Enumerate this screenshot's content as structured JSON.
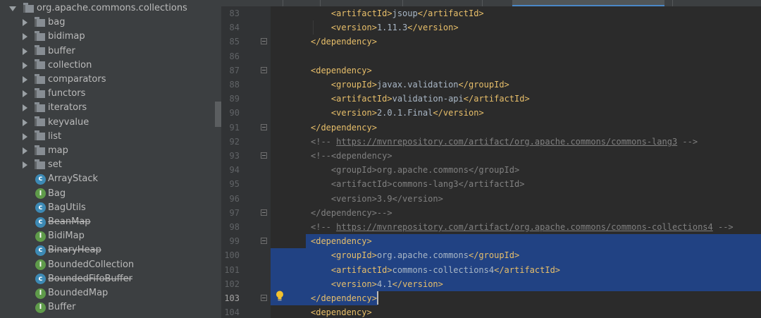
{
  "project_tree": {
    "root": {
      "label": "org.apache.commons.collections",
      "expanded": true
    },
    "folders": [
      "bag",
      "bidimap",
      "buffer",
      "collection",
      "comparators",
      "functors",
      "iterators",
      "keyvalue",
      "list",
      "map",
      "set"
    ],
    "classes": [
      {
        "label": "ArrayStack",
        "kind": "class",
        "deprecated": false
      },
      {
        "label": "Bag",
        "kind": "interface",
        "deprecated": false
      },
      {
        "label": "BagUtils",
        "kind": "class",
        "deprecated": false
      },
      {
        "label": "BeanMap",
        "kind": "class",
        "deprecated": true
      },
      {
        "label": "BidiMap",
        "kind": "interface",
        "deprecated": false
      },
      {
        "label": "BinaryHeap",
        "kind": "class",
        "deprecated": true
      },
      {
        "label": "BoundedCollection",
        "kind": "interface",
        "deprecated": false
      },
      {
        "label": "BoundedFifoBuffer",
        "kind": "class",
        "deprecated": true
      },
      {
        "label": "BoundedMap",
        "kind": "interface",
        "deprecated": false
      },
      {
        "label": "Buffer",
        "kind": "interface",
        "deprecated": false
      }
    ],
    "icon_letters": {
      "class": "c",
      "interface": "I"
    }
  },
  "editor": {
    "current_line": "103",
    "lines": [
      {
        "n": "83",
        "indent": "    ",
        "parts": [
          [
            "tag",
            "<artifactId>"
          ],
          [
            "txt",
            "jsoup"
          ],
          [
            "tag",
            "</artifactId>"
          ]
        ]
      },
      {
        "n": "84",
        "indent": "    ",
        "parts": [
          [
            "tag",
            "<version>"
          ],
          [
            "txt",
            "1.11.3"
          ],
          [
            "tag",
            "</version>"
          ]
        ]
      },
      {
        "n": "85",
        "indent": "",
        "parts": [
          [
            "tag",
            "</dependency>"
          ]
        ]
      },
      {
        "n": "86",
        "indent": "",
        "parts": []
      },
      {
        "n": "87",
        "indent": "",
        "parts": [
          [
            "tag",
            "<dependency>"
          ]
        ]
      },
      {
        "n": "88",
        "indent": "    ",
        "parts": [
          [
            "tag",
            "<groupId>"
          ],
          [
            "txt",
            "javax.validation"
          ],
          [
            "tag",
            "</groupId>"
          ]
        ]
      },
      {
        "n": "89",
        "indent": "    ",
        "parts": [
          [
            "tag",
            "<artifactId>"
          ],
          [
            "txt",
            "validation-api"
          ],
          [
            "tag",
            "</artifactId>"
          ]
        ]
      },
      {
        "n": "90",
        "indent": "    ",
        "parts": [
          [
            "tag",
            "<version>"
          ],
          [
            "txt",
            "2.0.1.Final"
          ],
          [
            "tag",
            "</version>"
          ]
        ]
      },
      {
        "n": "91",
        "indent": "",
        "parts": [
          [
            "tag",
            "</dependency>"
          ]
        ]
      },
      {
        "n": "92",
        "indent": "",
        "parts": [
          [
            "cmt",
            "<!-- "
          ],
          [
            "link",
            "https://mvnrepository.com/artifact/org.apache.commons/commons-lang3"
          ],
          [
            "cmt",
            " -->"
          ]
        ]
      },
      {
        "n": "93",
        "indent": "",
        "parts": [
          [
            "cmt",
            "<!--<dependency>"
          ]
        ]
      },
      {
        "n": "94",
        "indent": "    ",
        "parts": [
          [
            "cmt",
            "<groupId>org.apache.commons</groupId>"
          ]
        ]
      },
      {
        "n": "95",
        "indent": "    ",
        "parts": [
          [
            "cmt",
            "<artifactId>commons-lang3</artifactId>"
          ]
        ]
      },
      {
        "n": "96",
        "indent": "    ",
        "parts": [
          [
            "cmt",
            "<version>3.9</version>"
          ]
        ]
      },
      {
        "n": "97",
        "indent": "",
        "parts": [
          [
            "cmt",
            "</dependency>-->"
          ]
        ]
      },
      {
        "n": "98",
        "indent": "",
        "parts": [
          [
            "cmt",
            "<!-- "
          ],
          [
            "link",
            "https://mvnrepository.com/artifact/org.apache.commons/commons-collections4"
          ],
          [
            "cmt",
            " -->"
          ]
        ]
      },
      {
        "n": "99",
        "indent": "",
        "parts": [
          [
            "tag",
            "<dependency>"
          ]
        ]
      },
      {
        "n": "100",
        "indent": "    ",
        "parts": [
          [
            "tag",
            "<groupId>"
          ],
          [
            "txt",
            "org.apache.commons"
          ],
          [
            "tag",
            "</groupId>"
          ]
        ]
      },
      {
        "n": "101",
        "indent": "    ",
        "parts": [
          [
            "tag",
            "<artifactId>"
          ],
          [
            "txt",
            "commons-collections4"
          ],
          [
            "tag",
            "</artifactId>"
          ]
        ]
      },
      {
        "n": "102",
        "indent": "    ",
        "parts": [
          [
            "tag",
            "<version>"
          ],
          [
            "txt",
            "4.1"
          ],
          [
            "tag",
            "</version>"
          ]
        ]
      },
      {
        "n": "103",
        "indent": "",
        "parts": [
          [
            "tag",
            "</dependency>"
          ]
        ]
      },
      {
        "n": "104",
        "indent": "",
        "parts": [
          [
            "tag",
            "<dependency>"
          ]
        ]
      }
    ],
    "selected_lines": [
      "99",
      "100",
      "101",
      "102",
      "103"
    ],
    "folded_markers": [
      "85",
      "87",
      "91",
      "93",
      "97",
      "99",
      "103"
    ]
  },
  "colors": {
    "xml_tag": "#e8bf6a",
    "text": "#a9b7c6",
    "comment": "#808080",
    "selection": "#214283",
    "tree_background": "#3c3f41",
    "editor_background": "#2b2b2b"
  }
}
